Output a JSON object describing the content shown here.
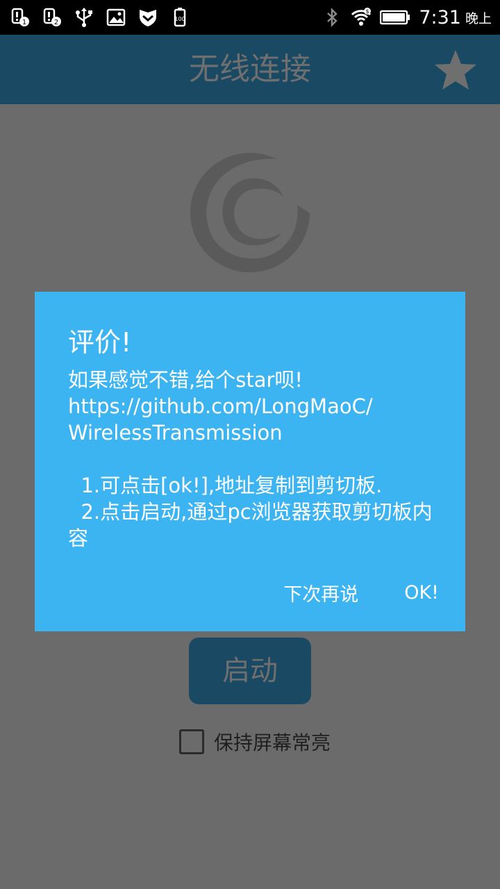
{
  "status_bar": {
    "time": "7:31",
    "ampm": "晚上",
    "icons_left": [
      "sim1-alert-icon",
      "sim2-alert-icon",
      "usb-icon",
      "image-icon",
      "shield-icon",
      "battery-card-icon"
    ],
    "icons_right": [
      "bluetooth-icon",
      "wifi-icon",
      "battery-icon"
    ]
  },
  "app": {
    "title": "无线连接",
    "start_label": "启动",
    "keep_screen_label": "保持屏幕常亮",
    "keep_screen_checked": false
  },
  "dialog": {
    "title": "评价!",
    "message": "如果感觉不错,给个star呗!\nhttps://github.com/LongMaoC/\nWirelessTransmission\n\n  1.可点击[ok!],地址复制到剪切板.\n  2.点击启动,通过pc浏览器获取剪切板内容",
    "negative_label": "下次再说",
    "positive_label": "OK!"
  },
  "colors": {
    "accent": "#3db4f2",
    "title_bar": "#1a4a63",
    "overlay_bg": "#6b6b6b"
  }
}
